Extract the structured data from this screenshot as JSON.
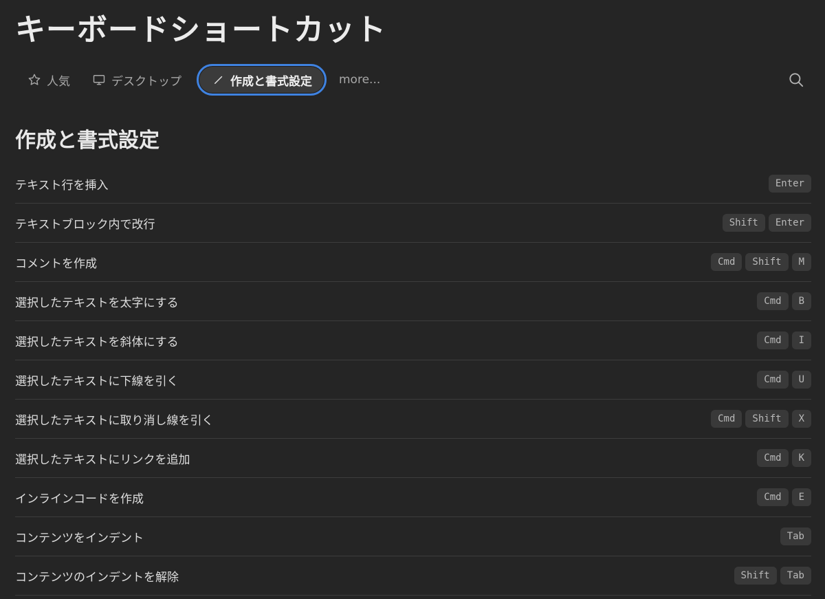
{
  "page": {
    "title": "キーボードショートカット"
  },
  "tabs": [
    {
      "label": "人気",
      "icon": "star-icon"
    },
    {
      "label": "デスクトップ",
      "icon": "monitor-icon"
    },
    {
      "label": "作成と書式設定",
      "icon": "pencil-icon",
      "active": true
    },
    {
      "label": "more..."
    }
  ],
  "search": {
    "icon": "search-icon"
  },
  "section": {
    "title": "作成と書式設定"
  },
  "shortcuts": [
    {
      "label": "テキスト行を挿入",
      "keys": [
        "Enter"
      ]
    },
    {
      "label": "テキストブロック内で改行",
      "keys": [
        "Shift",
        "Enter"
      ]
    },
    {
      "label": "コメントを作成",
      "keys": [
        "Cmd",
        "Shift",
        "M"
      ]
    },
    {
      "label": "選択したテキストを太字にする",
      "keys": [
        "Cmd",
        "B"
      ]
    },
    {
      "label": "選択したテキストを斜体にする",
      "keys": [
        "Cmd",
        "I"
      ]
    },
    {
      "label": "選択したテキストに下線を引く",
      "keys": [
        "Cmd",
        "U"
      ]
    },
    {
      "label": "選択したテキストに取り消し線を引く",
      "keys": [
        "Cmd",
        "Shift",
        "X"
      ]
    },
    {
      "label": "選択したテキストにリンクを追加",
      "keys": [
        "Cmd",
        "K"
      ]
    },
    {
      "label": "インラインコードを作成",
      "keys": [
        "Cmd",
        "E"
      ]
    },
    {
      "label": "コンテンツをインデント",
      "keys": [
        "Tab"
      ]
    },
    {
      "label": "コンテンツのインデントを解除",
      "keys": [
        "Shift",
        "Tab"
      ]
    }
  ],
  "colors": {
    "background": "#252525",
    "active_tab_border": "#3f82e0",
    "key_background": "#393939"
  }
}
